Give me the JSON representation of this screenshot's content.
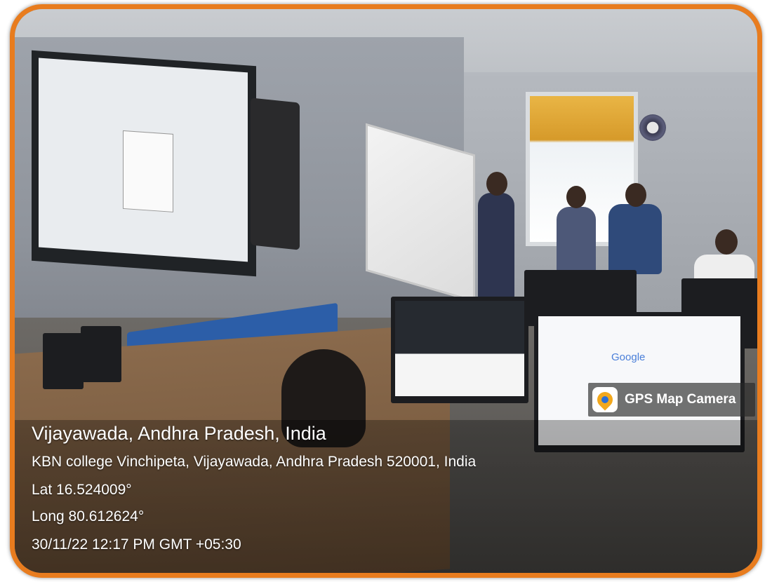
{
  "frame": {
    "border_color": "#e87c1e"
  },
  "badge": {
    "icon": "gps-map-camera-logo-icon",
    "label": "GPS Map Camera"
  },
  "location": {
    "city_line": "Vijayawada, Andhra Pradesh, India",
    "address": "KBN college Vinchipeta, Vijayawada, Andhra Pradesh 520001, India",
    "latitude": "Lat 16.524009°",
    "longitude": "Long 80.612624°",
    "timestamp": "30/11/22 12:17 PM GMT +05:30"
  },
  "screens": {
    "google_logo_text": "Google"
  }
}
